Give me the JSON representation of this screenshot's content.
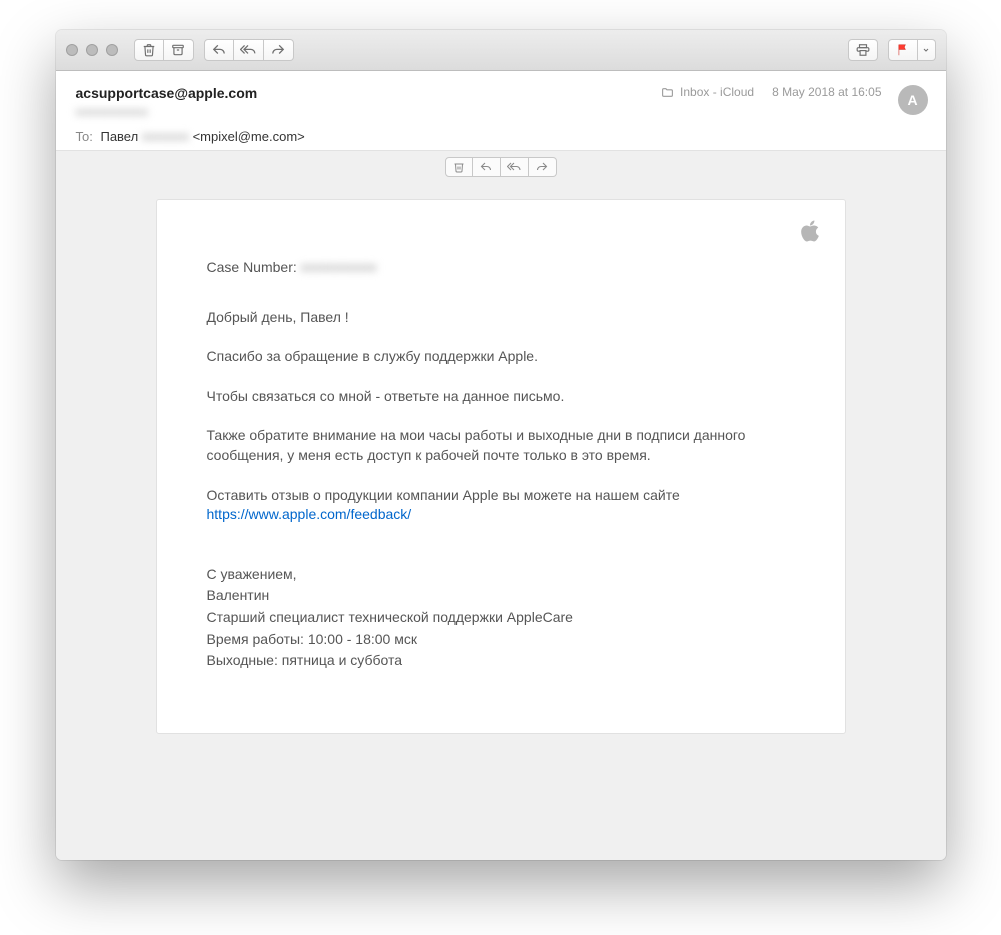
{
  "header": {
    "from": "acsupportcase@apple.com",
    "to_label": "To:",
    "to_name": "Павел",
    "to_addr": "<mpixel@me.com>",
    "folder": "Inbox - iCloud",
    "date": "8 May 2018 at 16:05",
    "avatar_letter": "A"
  },
  "body": {
    "case_label": "Case Number:",
    "p1": "Добрый день, Павел !",
    "p2": "Спасибо за обращение в службу поддержки Apple.",
    "p3": "Чтобы связаться со мной - ответьте на данное письмо.",
    "p4": "Также обратите внимание на мои часы работы и выходные дни в подписи данного сообщения, у меня есть доступ к рабочей почте только в это время.",
    "p5_pre": "Оставить отзыв о продукции компании Apple вы можете на нашем сайте ",
    "p5_link": "https://www.apple.com/feedback/",
    "sig1": "С уважением,",
    "sig2": "Валентин",
    "sig3": "Старший специалист технической поддержки AppleCare",
    "sig4": "Время работы: 10:00 - 18:00 мск",
    "sig5": "Выходные: пятница и суббота"
  }
}
